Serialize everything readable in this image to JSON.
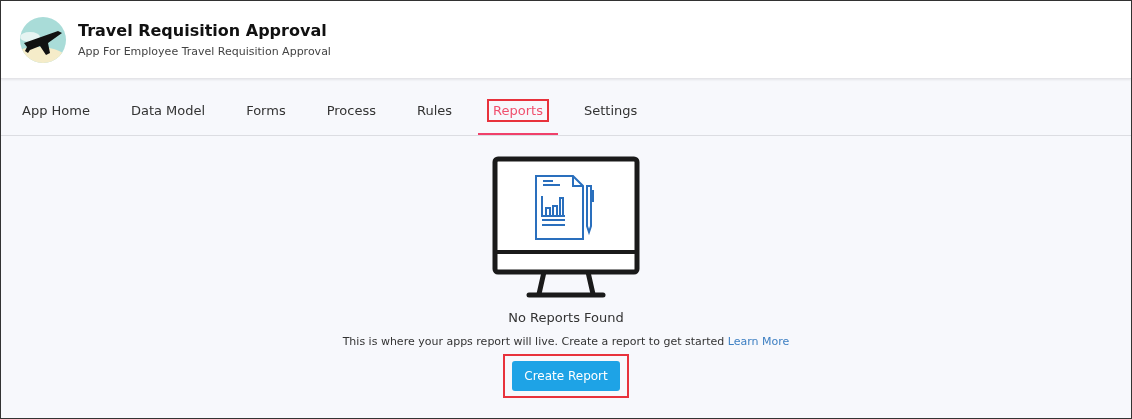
{
  "app": {
    "title": "Travel Requisition Approval",
    "subtitle": "App For Employee Travel Requisition Approval"
  },
  "tabs": [
    {
      "label": "App Home",
      "selected": false,
      "highlighted": false
    },
    {
      "label": "Data Model",
      "selected": false,
      "highlighted": false
    },
    {
      "label": "Forms",
      "selected": false,
      "highlighted": false
    },
    {
      "label": "Process",
      "selected": false,
      "highlighted": false
    },
    {
      "label": "Rules",
      "selected": false,
      "highlighted": false
    },
    {
      "label": "Reports",
      "selected": true,
      "highlighted": true
    },
    {
      "label": "Settings",
      "selected": false,
      "highlighted": false
    }
  ],
  "empty_state": {
    "heading": "No Reports Found",
    "message": "This is where your apps report will live. Create a report to get started",
    "link": "Learn More",
    "button": {
      "label": "Create Report",
      "highlighted": true
    }
  }
}
